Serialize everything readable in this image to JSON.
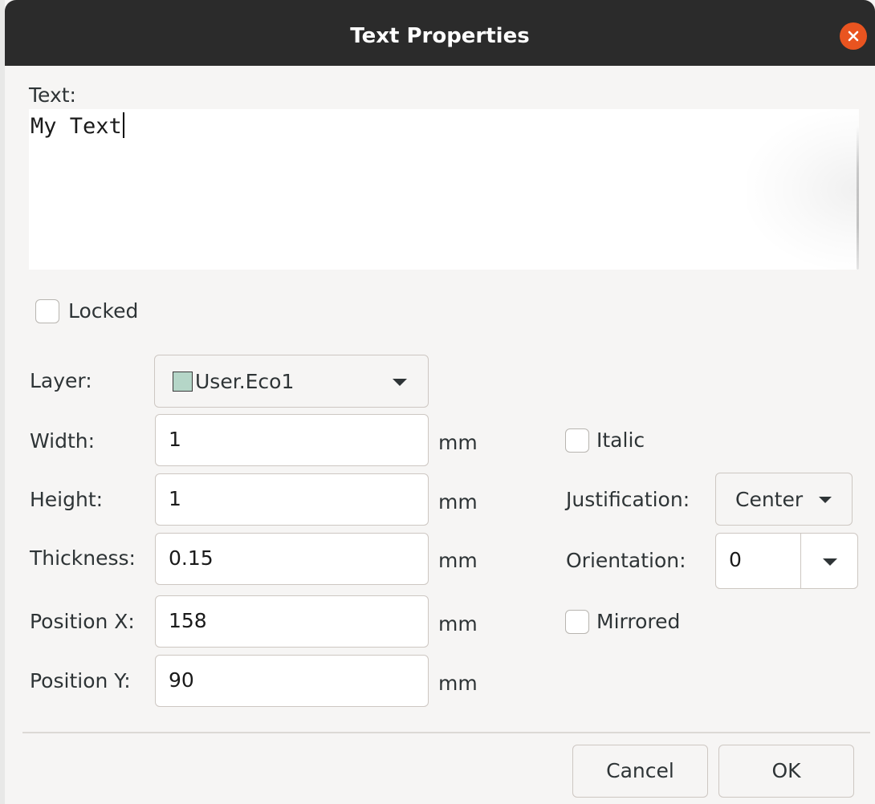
{
  "window": {
    "title": "Text Properties"
  },
  "text_field": {
    "label": "Text:",
    "value": "My Text"
  },
  "locked": {
    "label": "Locked",
    "checked": false
  },
  "layer": {
    "label": "Layer:",
    "value": "User.Eco1",
    "swatch_color": "#b5d6c8"
  },
  "fields": {
    "width": {
      "label": "Width:",
      "value": "1",
      "unit": "mm"
    },
    "height": {
      "label": "Height:",
      "value": "1",
      "unit": "mm"
    },
    "thickness": {
      "label": "Thickness:",
      "value": "0.15",
      "unit": "mm"
    },
    "position_x": {
      "label": "Position X:",
      "value": "158",
      "unit": "mm"
    },
    "position_y": {
      "label": "Position Y:",
      "value": "90",
      "unit": "mm"
    }
  },
  "italic": {
    "label": "Italic",
    "checked": false
  },
  "justification": {
    "label": "Justification:",
    "value": "Center"
  },
  "orientation": {
    "label": "Orientation:",
    "value": "0"
  },
  "mirrored": {
    "label": "Mirrored",
    "checked": false
  },
  "buttons": {
    "cancel": "Cancel",
    "ok": "OK"
  },
  "colors": {
    "titlebar": "#2b2b2b",
    "close_button": "#e95420",
    "dialog_background": "#f6f5f4"
  }
}
